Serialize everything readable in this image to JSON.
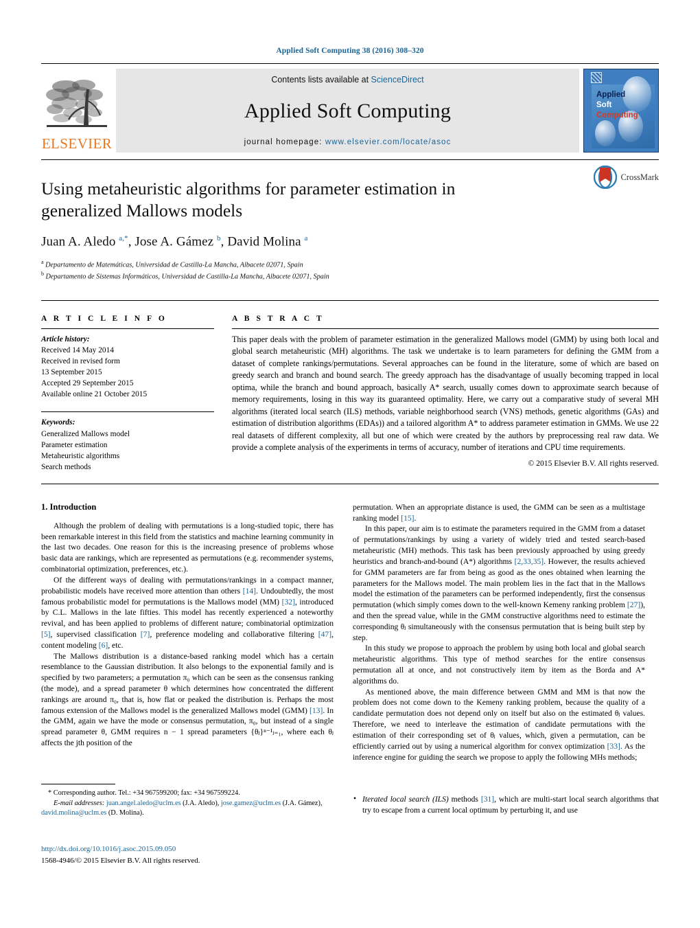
{
  "running_head": "Applied Soft Computing 38 (2016) 308–320",
  "banner": {
    "publisher_logo_text": "ELSEVIER",
    "contents_prefix": "Contents lists available at ",
    "contents_link": "ScienceDirect",
    "journal_name": "Applied Soft Computing",
    "homepage_prefix": "journal homepage: ",
    "homepage_url": "www.elsevier.com/locate/asoc",
    "cover": {
      "line1": "Applied",
      "line2": "Soft",
      "line3": "Computing"
    }
  },
  "title": "Using metaheuristic algorithms for parameter estimation in generalized Mallows models",
  "authors_html": "Juan A. Aledo <sup>a,*</sup>, Jose A. Gámez <sup>b</sup>, David Molina <sup>a</sup>",
  "affiliations": [
    "Departamento de Matemáticas, Universidad de Castilla-La Mancha, Albacete 02071, Spain",
    "Departamento de Sistemas Informáticos, Universidad de Castilla-La Mancha, Albacete 02071, Spain"
  ],
  "crossmark_label": "CrossMark",
  "article_info": {
    "heading": "A R T I C L E   I N F O",
    "history_label": "Article history:",
    "history": [
      "Received 14 May 2014",
      "Received in revised form",
      "13 September 2015",
      "Accepted 29 September 2015",
      "Available online 21 October 2015"
    ],
    "keywords_label": "Keywords:",
    "keywords": [
      "Generalized Mallows model",
      "Parameter estimation",
      "Metaheuristic algorithms",
      "Search methods"
    ]
  },
  "abstract": {
    "heading": "A B S T R A C T",
    "text": "This paper deals with the problem of parameter estimation in the generalized Mallows model (GMM) by using both local and global search metaheuristic (MH) algorithms. The task we undertake is to learn parameters for defining the GMM from a dataset of complete rankings/permutations. Several approaches can be found in the literature, some of which are based on greedy search and branch and bound search. The greedy approach has the disadvantage of usually becoming trapped in local optima, while the branch and bound approach, basically A* search, usually comes down to approximate search because of memory requirements, losing in this way its guaranteed optimality. Here, we carry out a comparative study of several MH algorithms (iterated local search (ILS) methods, variable neighborhood search (VNS) methods, genetic algorithms (GAs) and estimation of distribution algorithms (EDAs)) and a tailored algorithm A* to address parameter estimation in GMMs. We use 22 real datasets of different complexity, all but one of which were created by the authors by preprocessing real raw data. We provide a complete analysis of the experiments in terms of accuracy, number of iterations and CPU time requirements.",
    "copyright": "© 2015 Elsevier B.V. All rights reserved."
  },
  "body": {
    "section_number_title": "1.  Introduction",
    "left_paragraphs": [
      "Although the problem of dealing with permutations is a long-studied topic, there has been remarkable interest in this field from the statistics and machine learning community in the last two decades. One reason for this is the increasing presence of problems whose basic data are rankings, which are represented as permutations (e.g. recommender systems, combinatorial optimization, preferences, etc.).",
      "Of the different ways of dealing with permutations/rankings in a compact manner, probabilistic models have received more attention than others [14]. Undoubtedly, the most famous probabilistic model for permutations is the Mallows model (MM) [32], introduced by C.L. Mallows in the late fifties. This model has recently experienced a noteworthy revival, and has been applied to problems of different nature; combinatorial optimization [5], supervised classification [7], preference modeling and collaborative filtering [47], content modeling [6], etc.",
      "The Mallows distribution is a distance-based ranking model which has a certain resemblance to the Gaussian distribution. It also belongs to the exponential family and is specified by two parameters; a permutation π₀ which can be seen as the consensus ranking (the mode), and a spread parameter θ which determines how concentrated the different rankings are around π₀, that is, how flat or peaked the distribution is. Perhaps the most famous extension of the Mallows model is the generalized Mallows model (GMM) [13]. In the GMM, again we have the mode or consensus permutation, π₀, but instead of a single spread parameter θ, GMM requires n − 1 spread parameters {θⱼ}ⁿ⁻¹ⱼ₌₁, where each θⱼ affects the jth position of the"
    ],
    "right_paragraphs": [
      "permutation. When an appropriate distance is used, the GMM can be seen as a multistage ranking model [15].",
      "In this paper, our aim is to estimate the parameters required in the GMM from a dataset of permutations/rankings by using a variety of widely tried and tested search-based metaheuristic (MH) methods. This task has been previously approached by using greedy heuristics and branch-and-bound (A*) algorithms [2,33,35]. However, the results achieved for GMM parameters are far from being as good as the ones obtained when learning the parameters for the Mallows model. The main problem lies in the fact that in the Mallows model the estimation of the parameters can be performed independently, first the consensus permutation (which simply comes down to the well-known Kemeny ranking problem [27]), and then the spread value, while in the GMM constructive algorithms need to estimate the corresponding θⱼ simultaneously with the consensus permutation that is being built step by step.",
      "In this study we propose to approach the problem by using both local and global search metaheuristic algorithms. This type of method searches for the entire consensus permutation all at once, and not constructively item by item as the Borda and A* algorithms do.",
      "As mentioned above, the main difference between GMM and MM is that now the problem does not come down to the Kemeny ranking problem, because the quality of a candidate permutation does not depend only on itself but also on the estimated θⱼ values. Therefore, we need to interleave the estimation of candidate permutations with the estimation of their corresponding set of θⱼ values, which, given a permutation, can be efficiently carried out by using a numerical algorithm for convex optimization [33]. As the inference engine for guiding the search we propose to apply the following MHs methods;"
    ],
    "bullets": [
      "Iterated local search (ILS) methods [31], which are multi-start local search algorithms that try to escape from a current local optimum by perturbing it, and use"
    ]
  },
  "footnote": {
    "corresponding": "*  Corresponding author. Tel.: +34 967599200; fax: +34 967599224.",
    "email_label": "E-mail addresses:",
    "emails": [
      {
        "address": "juan.angel.aledo@uclm.es",
        "owner": "(J.A. Aledo)"
      },
      {
        "address": "jose.gamez@uclm.es",
        "owner": "(J.A. Gámez)"
      },
      {
        "address": "david.molina@uclm.es",
        "owner": "(D. Molina)"
      }
    ]
  },
  "doi_block": {
    "doi_url": "http://dx.doi.org/10.1016/j.asoc.2015.09.050",
    "issn_line": "1568-4946/© 2015 Elsevier B.V. All rights reserved."
  },
  "colors": {
    "link_blue": "#1a6496",
    "elsevier_orange": "#E87722",
    "cover_blue": "#3f7fc1",
    "crossmark_red": "#cc3322"
  }
}
